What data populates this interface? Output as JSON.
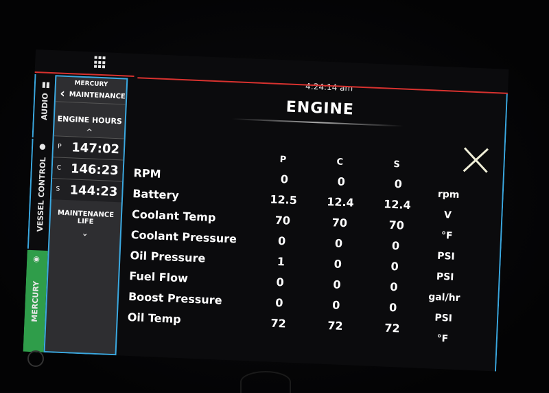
{
  "header": {
    "time": "4:24:14 am",
    "title": "ENGINE"
  },
  "side_tabs": {
    "audio": "AUDIO",
    "vessel": "VESSEL CONTROL",
    "mercury": "MERCURY"
  },
  "menu": {
    "brand": "MERCURY",
    "back_label": "MAINTENANCE",
    "engine_hours_label": "ENGINE HOURS",
    "hours": [
      {
        "key": "P",
        "value": "147:02"
      },
      {
        "key": "C",
        "value": "146:23"
      },
      {
        "key": "S",
        "value": "144:23"
      }
    ],
    "maintenance_life_label": "MAINTENANCE LIFE"
  },
  "columns": [
    "P",
    "C",
    "S"
  ],
  "rows": [
    {
      "name": "RPM",
      "p": "0",
      "c": "0",
      "s": "0"
    },
    {
      "name": "Battery",
      "p": "12.5",
      "c": "12.4",
      "s": "12.4"
    },
    {
      "name": "Coolant Temp",
      "p": "70",
      "c": "70",
      "s": "70"
    },
    {
      "name": "Coolant Pressure",
      "p": "0",
      "c": "0",
      "s": "0"
    },
    {
      "name": "Oil Pressure",
      "p": "1",
      "c": "0",
      "s": "0"
    },
    {
      "name": "Fuel Flow",
      "p": "0",
      "c": "0",
      "s": "0"
    },
    {
      "name": "Boost Pressure",
      "p": "0",
      "c": "0",
      "s": "0"
    },
    {
      "name": "Oil Temp",
      "p": "72",
      "c": "72",
      "s": "72"
    }
  ],
  "units": [
    "rpm",
    "V",
    "°F",
    "PSI",
    "PSI",
    "gal/hr",
    "PSI",
    "°F"
  ]
}
